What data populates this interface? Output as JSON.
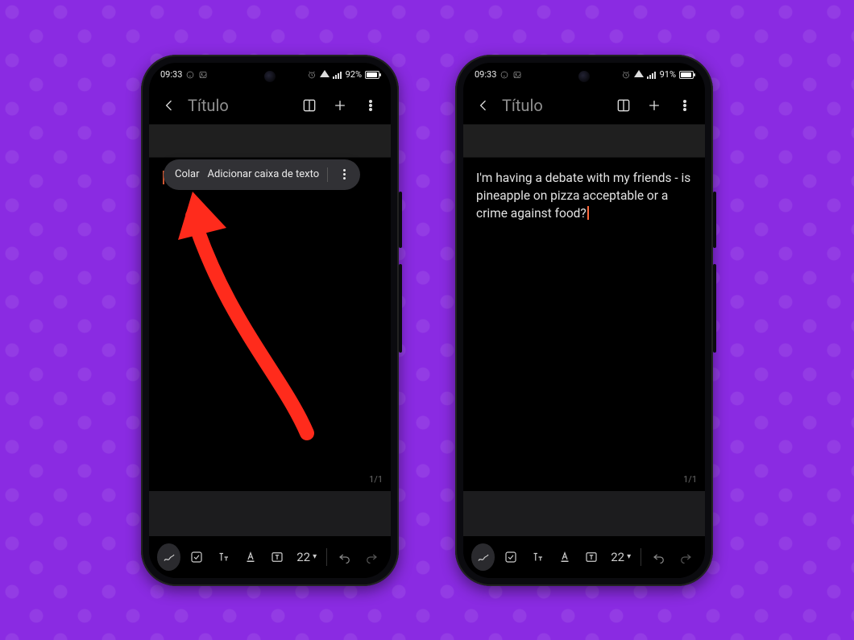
{
  "status": {
    "time": "09:33",
    "left_icons": [
      "whatsapp-icon",
      "image-icon"
    ],
    "right_icons": [
      "alarm-icon",
      "wifi-icon",
      "signal-icon"
    ]
  },
  "phone_left": {
    "battery_text": "92%",
    "battery_fill_pct": 92
  },
  "phone_right": {
    "battery_text": "91%",
    "battery_fill_pct": 91
  },
  "appbar": {
    "title": "Título"
  },
  "context_menu": {
    "paste": "Colar",
    "add_textbox": "Adicionar caixa de texto"
  },
  "editor": {
    "note_text": "I'm having a debate with my friends - is pineapple on pizza acceptable or a crime against food?",
    "page_counter": "1/1"
  },
  "toolbar": {
    "font_size": "22"
  },
  "colors": {
    "background": "#8a2be2",
    "annotation_red": "#ff2b1c"
  }
}
